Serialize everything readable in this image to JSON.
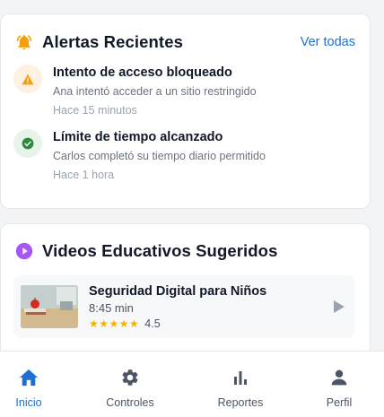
{
  "alerts": {
    "title": "Alertas Recientes",
    "see_all": "Ver todas",
    "items": [
      {
        "icon": "warning-icon",
        "title": "Intento de acceso bloqueado",
        "description": "Ana intentó acceder a un sitio restringido",
        "time": "Hace 15 minutos"
      },
      {
        "icon": "check-circle-icon",
        "title": "Límite de tiempo alcanzado",
        "description": "Carlos completó su tiempo diario permitido",
        "time": "Hace 1 hora"
      }
    ]
  },
  "videos": {
    "title": "Videos Educativos Sugeridos",
    "items": [
      {
        "title": "Seguridad Digital para Niños",
        "duration": "8:45 min",
        "stars": "★★★★★",
        "rating": "4.5"
      }
    ]
  },
  "nav": {
    "items": [
      {
        "label": "Inicio",
        "icon": "home-icon",
        "active": true
      },
      {
        "label": "Controles",
        "icon": "gear-icon",
        "active": false
      },
      {
        "label": "Reportes",
        "icon": "bar-chart-icon",
        "active": false
      },
      {
        "label": "Perfil",
        "icon": "person-icon",
        "active": false
      }
    ]
  },
  "colors": {
    "accent": "#1d6fd1",
    "warning": "#f59e0b",
    "success": "#2e8b3e",
    "play_icon": "#a855f7",
    "star": "#f5b301"
  }
}
